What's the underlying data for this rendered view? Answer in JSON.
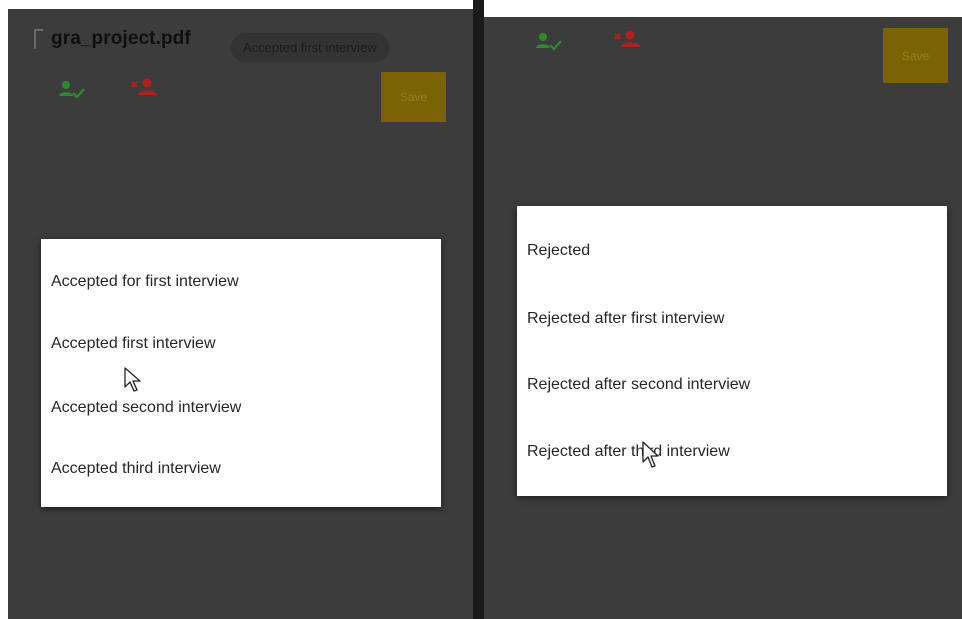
{
  "left_panel": {
    "file_name": "gra_project.pdf",
    "tooltip": "Accepted first interview",
    "icons": [
      "accept-person-icon",
      "reject-person-icon"
    ],
    "save_label": "Save",
    "options": [
      "Accepted for first interview",
      "Accepted first interview",
      "Accepted second interview",
      "Accepted third interview"
    ]
  },
  "right_panel": {
    "icons": [
      "accept-person-icon",
      "reject-person-icon"
    ],
    "save_label": "Save",
    "options": [
      "Rejected",
      "Rejected after first interview",
      "Rejected after second interview",
      "Rejected after third interview"
    ]
  },
  "colors": {
    "background": "#3c3c3c",
    "accept_icon": "#2f8a2f",
    "reject_icon": "#b21f1f",
    "save_button": "#7a6205"
  }
}
